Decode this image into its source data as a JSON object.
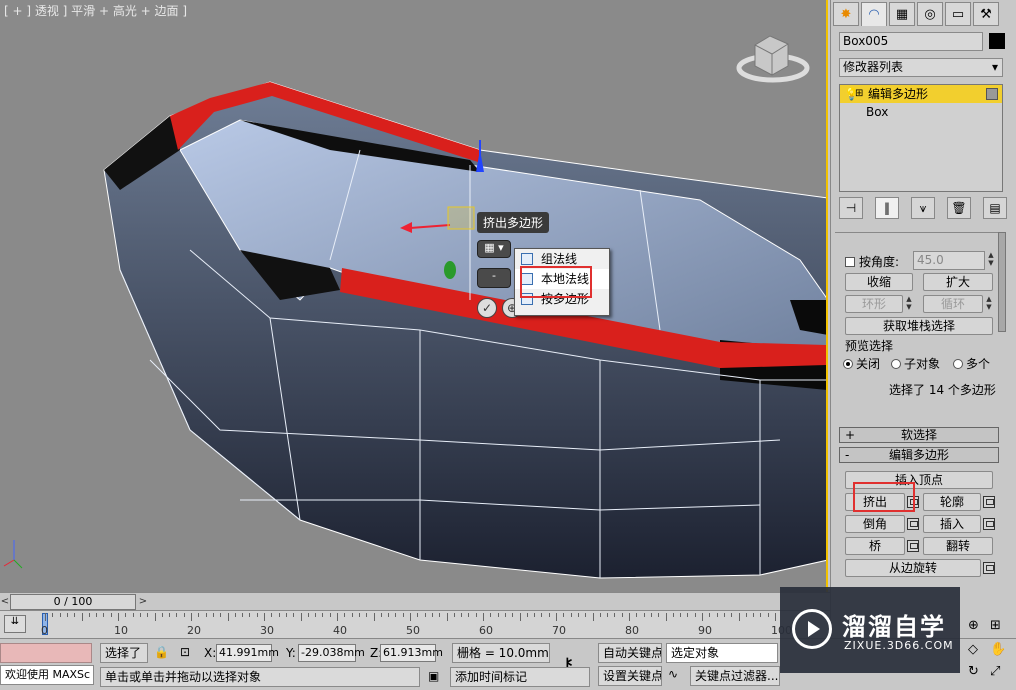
{
  "viewport": {
    "label": "[ + ] 透视 ] 平滑 + 高光 + 边面 ]",
    "caddy_title": "挤出多边形",
    "context_menu": [
      {
        "label": "组法线",
        "icon": "group-normal-icon"
      },
      {
        "label": "本地法线",
        "icon": "local-normal-icon",
        "selected": true
      },
      {
        "label": "按多边形",
        "icon": "by-polygon-icon"
      }
    ],
    "caddy_ok": "✓",
    "caddy_dash": "-"
  },
  "panel": {
    "tabs": [
      "create-tab-icon",
      "modify-tab-icon",
      "hierarchy-tab-icon",
      "motion-tab-icon",
      "display-tab-icon",
      "utilities-tab-icon"
    ],
    "object_name": "Box005",
    "modifier_list": "修改器列表",
    "stack": [
      {
        "label": "编辑多边形",
        "selected": true
      },
      {
        "label": "Box",
        "selected": false
      }
    ],
    "select_by_angle_label": "按角度:",
    "angle_value": "45.0",
    "shrink": "收缩",
    "grow": "扩大",
    "ring": "环形",
    "loop": "循环",
    "get_stack_selection": "获取堆栈选择",
    "preview_selection_label": "预览选择",
    "preview_options": [
      {
        "label": "关闭",
        "on": true
      },
      {
        "label": "子对象",
        "on": false
      },
      {
        "label": "多个",
        "on": false
      }
    ],
    "selection_info": "选择了 14 个多边形",
    "soft_selection": "软选择",
    "soft_selection_sign": "+",
    "edit_polygons": "编辑多边形",
    "edit_polygons_sign": "-",
    "insert_vertex": "插入顶点",
    "extrude": "挤出",
    "outline": "轮廓",
    "bevel": "倒角",
    "inset": "插入",
    "bridge": "桥",
    "flip": "翻转",
    "hinge_from_edge": "从边旋转"
  },
  "timeline": {
    "frame_display": "0 / 100",
    "ticks": [
      "0",
      "10",
      "20",
      "30",
      "40",
      "50",
      "60",
      "70",
      "80",
      "90",
      "100"
    ]
  },
  "status": {
    "maxscript": "欢迎使用 MAXSc",
    "selection": "选择了",
    "x_label": "X:",
    "x_value": "41.991mm",
    "y_label": "Y:",
    "y_value": "-29.038mm",
    "z_label": "Z:",
    "z_value": "61.913mm",
    "grid": "栅格 = 10.0mm",
    "auto_key": "自动关键点",
    "selected_object": "选定对象",
    "set_key": "设置关键点",
    "key_filters": "关键点过滤器...",
    "prompt": "单击或单击并拖动以选择对象",
    "add_time_tag": "添加时间标记"
  },
  "watermark": {
    "title": "溜溜自学",
    "subtitle": "ZIXUE.3D66.COM"
  },
  "colors": {
    "selection_red": "#e0302f",
    "highlight_yellow": "#f2cf2e",
    "viewport_bg": "#8a8a8a"
  }
}
